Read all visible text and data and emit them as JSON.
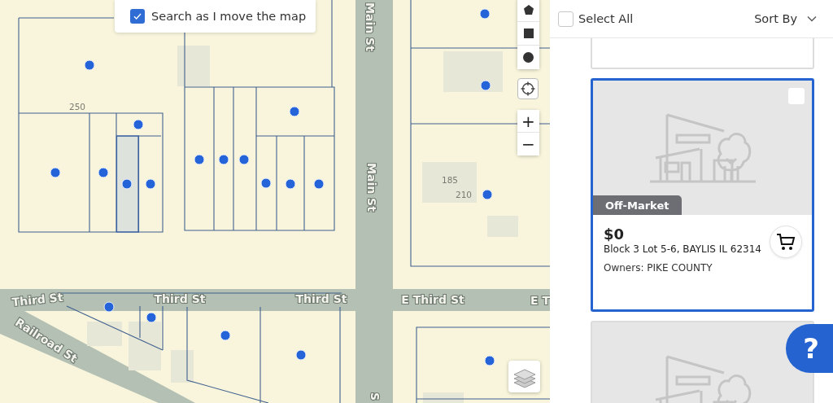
{
  "map": {
    "search_toggle": {
      "label": "Search as I move the map",
      "checked": true
    },
    "streets": [
      {
        "label": "Main St"
      },
      {
        "label": "Main St"
      },
      {
        "label": "Third St"
      },
      {
        "label": "Third St"
      },
      {
        "label": "Third St"
      },
      {
        "label": "E Third St"
      },
      {
        "label": "E T"
      },
      {
        "label": "Railroad St"
      },
      {
        "label": "S"
      }
    ],
    "parcel_numbers": [
      "250",
      "185",
      "210"
    ],
    "zoom_in": "+",
    "zoom_out": "−"
  },
  "results": {
    "select_all": {
      "label": "Select All",
      "checked": false
    },
    "sort": {
      "label": "Sort By"
    },
    "listings": [
      {
        "selected": false
      },
      {
        "selected": true,
        "checked": false,
        "status": "Off-Market",
        "price": "$0",
        "address": "Block 3 Lot 5-6, BAYLIS IL 62314",
        "owners": "Owners: PIKE COUNTY"
      },
      {
        "selected": false
      }
    ],
    "help": "?"
  }
}
